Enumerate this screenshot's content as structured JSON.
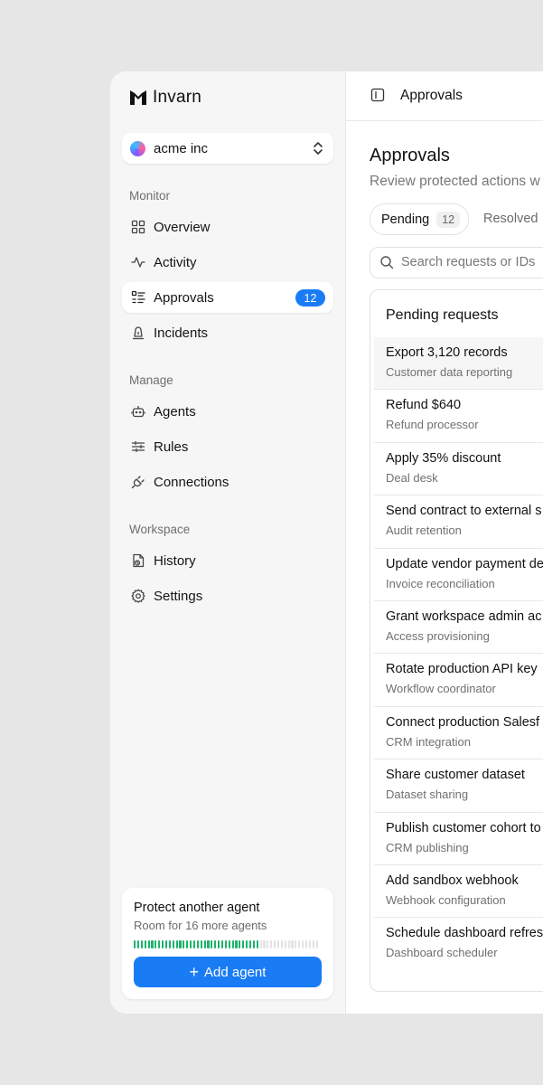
{
  "app": {
    "name": "Invarn"
  },
  "org": {
    "name": "acme inc"
  },
  "sidebar": {
    "sections": [
      {
        "label": "Monitor"
      },
      {
        "label": "Manage"
      },
      {
        "label": "Workspace"
      }
    ],
    "items": [
      {
        "label": "Overview",
        "icon": "grid-icon"
      },
      {
        "label": "Activity",
        "icon": "pulse-icon"
      },
      {
        "label": "Approvals",
        "icon": "list-check-icon",
        "badge": "12",
        "active": true
      },
      {
        "label": "Incidents",
        "icon": "alarm-icon"
      },
      {
        "label": "Agents",
        "icon": "robot-icon"
      },
      {
        "label": "Rules",
        "icon": "sliders-icon"
      },
      {
        "label": "Connections",
        "icon": "plug-icon"
      },
      {
        "label": "History",
        "icon": "history-file-icon"
      },
      {
        "label": "Settings",
        "icon": "gear-icon"
      }
    ]
  },
  "promo": {
    "title": "Protect another agent",
    "subtitle": "Room for 16 more agents",
    "usage_fraction": 0.68,
    "button_label": "Add agent"
  },
  "topbar": {
    "breadcrumb": "Approvals"
  },
  "page": {
    "title": "Approvals",
    "subtitle": "Review protected actions w"
  },
  "tabs": {
    "pending_label": "Pending",
    "pending_count": "12",
    "resolved_label": "Resolved"
  },
  "search": {
    "placeholder": "Search requests or IDs",
    "value": ""
  },
  "list": {
    "heading": "Pending requests",
    "rows": [
      {
        "title": "Export 3,120 records",
        "subtitle": "Customer data reporting"
      },
      {
        "title": "Refund $640",
        "subtitle": "Refund processor"
      },
      {
        "title": "Apply 35% discount",
        "subtitle": "Deal desk"
      },
      {
        "title": "Send contract to external s",
        "subtitle": "Audit retention"
      },
      {
        "title": "Update vendor payment de",
        "subtitle": "Invoice reconciliation"
      },
      {
        "title": "Grant workspace admin ac",
        "subtitle": "Access provisioning"
      },
      {
        "title": "Rotate production API key",
        "subtitle": "Workflow coordinator"
      },
      {
        "title": "Connect production Salesf",
        "subtitle": "CRM integration"
      },
      {
        "title": "Share customer dataset",
        "subtitle": "Dataset sharing"
      },
      {
        "title": "Publish customer cohort to",
        "subtitle": "CRM publishing"
      },
      {
        "title": "Add sandbox webhook",
        "subtitle": "Webhook configuration"
      },
      {
        "title": "Schedule dashboard refres",
        "subtitle": "Dashboard scheduler"
      }
    ]
  },
  "colors": {
    "accent": "#1a7cf5",
    "meter_on": "#1eb36b"
  }
}
